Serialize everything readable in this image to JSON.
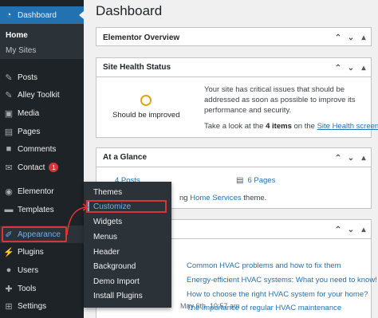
{
  "sidebar": {
    "dashboard": "Dashboard",
    "home": "Home",
    "my_sites": "My Sites",
    "items": [
      {
        "label": "Posts",
        "icon": "pin-icon"
      },
      {
        "label": "Alley Toolkit",
        "icon": "pin-icon"
      },
      {
        "label": "Media",
        "icon": "media-icon"
      },
      {
        "label": "Pages",
        "icon": "pages-icon"
      },
      {
        "label": "Comments",
        "icon": "comment-icon"
      },
      {
        "label": "Contact",
        "icon": "envelope-icon",
        "badge": "1"
      },
      {
        "label": "Elementor",
        "icon": "elementor-icon"
      },
      {
        "label": "Templates",
        "icon": "folder-icon"
      },
      {
        "label": "Appearance",
        "icon": "brush-icon"
      },
      {
        "label": "Plugins",
        "icon": "plug-icon"
      },
      {
        "label": "Users",
        "icon": "user-icon"
      },
      {
        "label": "Tools",
        "icon": "wrench-icon"
      },
      {
        "label": "Settings",
        "icon": "settings-icon"
      }
    ]
  },
  "flyout": {
    "items": [
      "Themes",
      "Customize",
      "Widgets",
      "Menus",
      "Header",
      "Background",
      "Demo Import",
      "Install Plugins"
    ]
  },
  "main": {
    "title": "Dashboard",
    "elementor_overview": "Elementor Overview",
    "site_health": {
      "title": "Site Health Status",
      "status": "Should be improved",
      "message": "Your site has critical issues that should be addressed as soon as possible to improve its performance and security.",
      "look_prefix": "Take a look at the ",
      "items_count": "4 items",
      "look_mid": " on the ",
      "link": "Site Health screen",
      "look_suffix": "."
    },
    "at_a_glance": {
      "title": "At a Glance",
      "posts": "4 Posts",
      "pages": "6 Pages",
      "theme_prefix": "ng ",
      "theme_link": "Home Services",
      "theme_suffix": " theme."
    },
    "news": [
      "Common HVAC problems and how to fix them",
      "Energy-efficient HVAC systems: What you need to know!",
      "How to choose the right HVAC system for your home?",
      "The importance of regular HVAC maintenance"
    ],
    "news_date": "May 6th, 10:57 am"
  },
  "colors": {
    "sidebar_bg": "#1d2327",
    "accent": "#2271b1",
    "highlight_box": "#d63638",
    "health_ring": "#dba617"
  }
}
